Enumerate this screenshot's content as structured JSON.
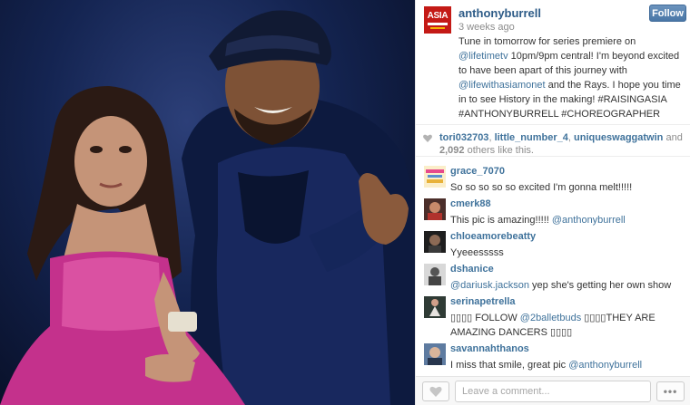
{
  "post": {
    "username": "anthonyburrell",
    "time_ago": "3 weeks ago",
    "follow_label": "Follow",
    "avatar_text": "ASIA",
    "caption": [
      {
        "t": "Tune in tomorrow for series premiere on ",
        "link": false
      },
      {
        "t": "@lifetimetv",
        "link": true
      },
      {
        "t": " 10pm/9pm central! I'm beyond excited to have been apart of this journey with ",
        "link": false
      },
      {
        "t": "@lifewithasiamonet",
        "link": true
      },
      {
        "t": " and the Rays. I hope you time in to see History in the making! #RAISINGASIA #ANTHONYBURRELL #CHOREOGRAPHER",
        "link": false
      }
    ]
  },
  "likes": {
    "users": [
      "tori032703",
      "little_number_4",
      "uniqueswaggatwin"
    ],
    "and": "and",
    "count": "2,092",
    "suffix": "others like this."
  },
  "comments": [
    {
      "user": "grace_7070",
      "parts": [
        {
          "t": "So so so so so excited I'm gonna melt!!!!!",
          "link": false
        }
      ],
      "avatar": "pink-logo"
    },
    {
      "user": "cmerk88",
      "parts": [
        {
          "t": "This pic is amazing!!!!! ",
          "link": false
        },
        {
          "t": "@anthonyburrell",
          "link": true
        }
      ],
      "avatar": "photo-red"
    },
    {
      "user": "chloeamorebeatty",
      "parts": [
        {
          "t": "Yyeeesssss",
          "link": false
        }
      ],
      "avatar": "photo-dark"
    },
    {
      "user": "dshanice",
      "parts": [
        {
          "t": "@dariusk.jackson",
          "link": true
        },
        {
          "t": " yep she's getting her own show",
          "link": false
        }
      ],
      "avatar": "photo-gray"
    },
    {
      "user": "serinapetrella",
      "parts": [
        {
          "t": "▯▯▯▯ FOLLOW ",
          "link": false
        },
        {
          "t": "@2balletbuds",
          "link": true
        },
        {
          "t": " ▯▯▯▯THEY ARE AMAZING DANCERS ▯▯▯▯",
          "link": false
        }
      ],
      "avatar": "photo-dancer"
    },
    {
      "user": "savannahthanos",
      "parts": [
        {
          "t": "I miss that smile, great pic ",
          "link": false
        },
        {
          "t": "@anthonyburrell",
          "link": true
        }
      ],
      "avatar": "photo-blue"
    }
  ],
  "footer": {
    "comment_placeholder": "Leave a comment...",
    "more_label": "•••"
  },
  "colors": {
    "link": "#3f729b",
    "username": "#2d5b87",
    "follow_button": "#4a77a7",
    "avatar_red": "#c41a16"
  },
  "icons": {
    "like": "heart-icon",
    "more": "ellipsis-icon"
  }
}
